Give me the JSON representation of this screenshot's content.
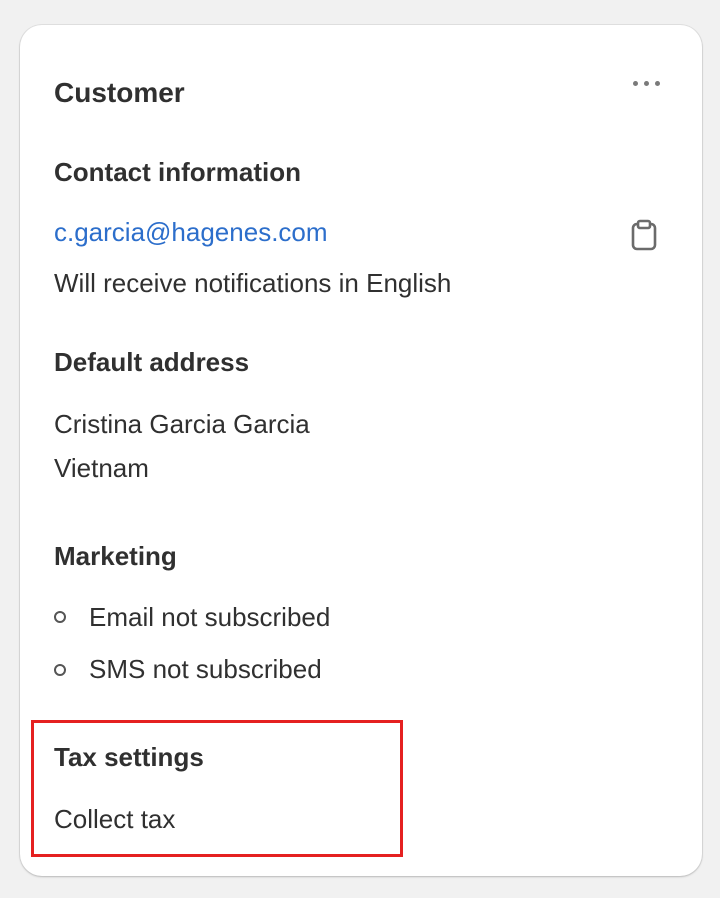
{
  "card": {
    "title": "Customer",
    "more_actions_icon": "ellipsis-horizontal-icon"
  },
  "contact": {
    "heading": "Contact information",
    "email": "c.garcia@hagenes.com",
    "copy_icon": "clipboard-icon",
    "notification_language": "Will receive notifications in English"
  },
  "address": {
    "heading": "Default address",
    "name": "Cristina Garcia Garcia",
    "country": "Vietnam"
  },
  "marketing": {
    "heading": "Marketing",
    "bullet_icon": "circle-outline-icon",
    "email_status": "Email not subscribed",
    "sms_status": "SMS not subscribed"
  },
  "tax": {
    "heading": "Tax settings",
    "value": "Collect tax"
  },
  "colors": {
    "link": "#2c6ecb",
    "text": "#303030",
    "highlight": "#e52020",
    "background": "#f1f1f1",
    "card": "#ffffff"
  }
}
